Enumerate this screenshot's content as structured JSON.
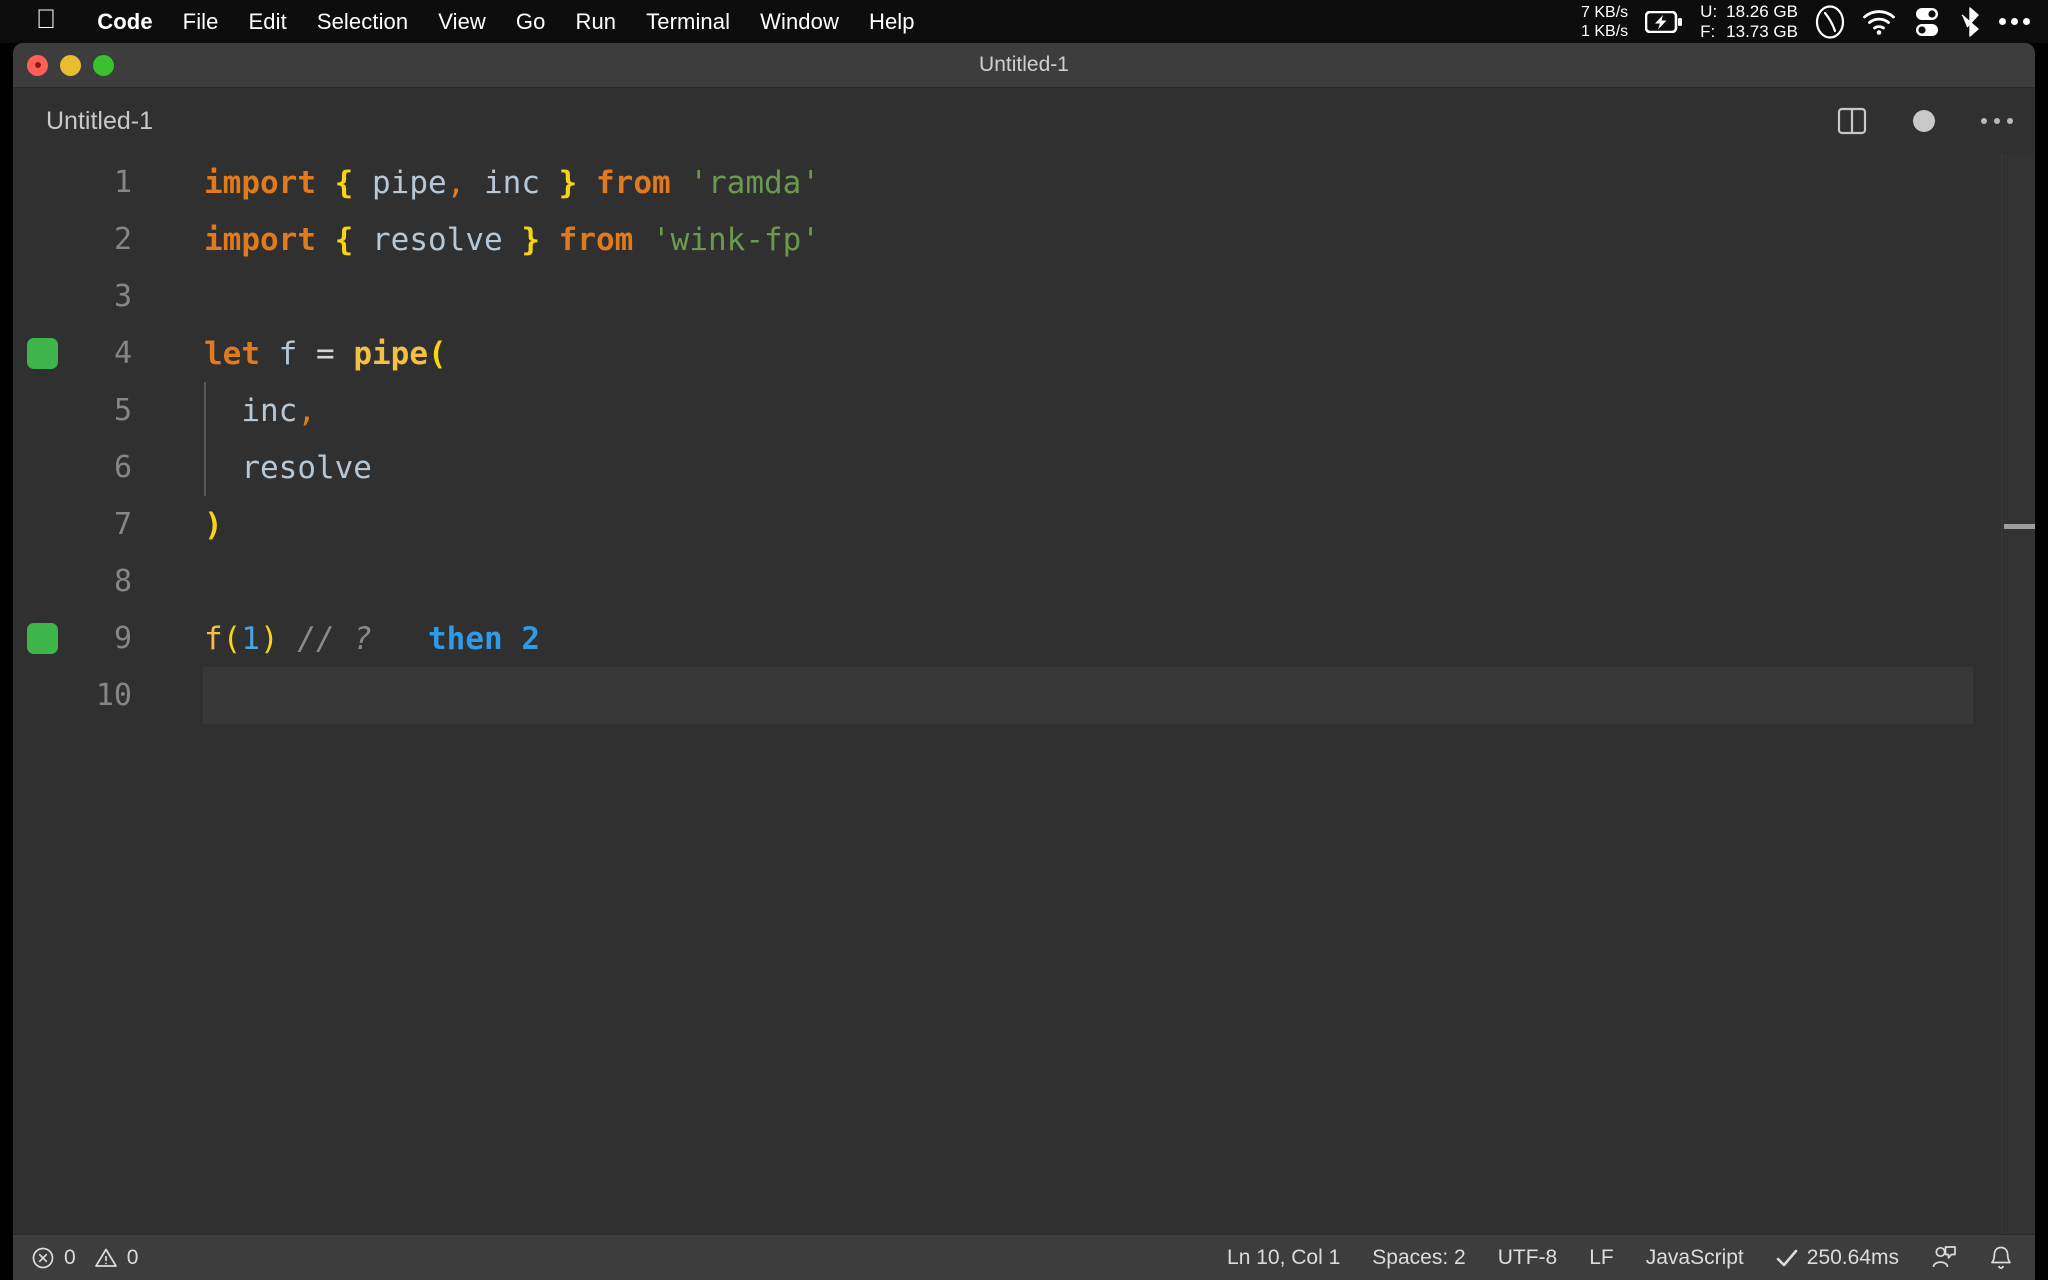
{
  "menubar": {
    "apple_icon": "apple-logo",
    "items": [
      {
        "label": "Code",
        "bold": true
      },
      {
        "label": "File",
        "bold": false
      },
      {
        "label": "Edit",
        "bold": false
      },
      {
        "label": "Selection",
        "bold": false
      },
      {
        "label": "View",
        "bold": false
      },
      {
        "label": "Go",
        "bold": false
      },
      {
        "label": "Run",
        "bold": false
      },
      {
        "label": "Terminal",
        "bold": false
      },
      {
        "label": "Window",
        "bold": false
      },
      {
        "label": "Help",
        "bold": false
      }
    ],
    "status": {
      "net_up": "7 KB/s",
      "net_down": "1 KB/s",
      "battery_icon": "battery-charging-icon",
      "mem_used_label": "U:",
      "mem_used_value": "18.26 GB",
      "mem_free_label": "F:",
      "mem_free_value": "13.73 GB",
      "gauge_icon": "speedometer-icon",
      "wifi_icon": "wifi-icon",
      "toggles_icon": "control-center-icon",
      "bluetooth_icon": "bluetooth-icon",
      "more_icon": "ellipsis-icon"
    }
  },
  "window": {
    "title": "Untitled-1",
    "traffic_lights": [
      "close",
      "minimize",
      "zoom"
    ]
  },
  "tabstrip": {
    "tab_label": "Untitled-1",
    "split_editor_icon": "split-editor-icon",
    "unsaved_dot": "unsaved-changes-dot",
    "more_actions_icon": "ellipsis-icon"
  },
  "editor": {
    "language": "JavaScript",
    "lines": [
      {
        "number": "1",
        "breakpoint": false,
        "current": false,
        "indent_guide": false,
        "tokens": [
          {
            "text": "import",
            "cls": "t-kw"
          },
          {
            "text": " ",
            "cls": "t-op"
          },
          {
            "text": "{",
            "cls": "t-brace"
          },
          {
            "text": " ",
            "cls": "t-op"
          },
          {
            "text": "pipe",
            "cls": "t-var"
          },
          {
            "text": ",",
            "cls": "t-punc"
          },
          {
            "text": " ",
            "cls": "t-op"
          },
          {
            "text": "inc",
            "cls": "t-var"
          },
          {
            "text": " ",
            "cls": "t-op"
          },
          {
            "text": "}",
            "cls": "t-brace"
          },
          {
            "text": " ",
            "cls": "t-op"
          },
          {
            "text": "from",
            "cls": "t-kw"
          },
          {
            "text": " ",
            "cls": "t-op"
          },
          {
            "text": "'ramda'",
            "cls": "t-str"
          }
        ]
      },
      {
        "number": "2",
        "breakpoint": false,
        "current": false,
        "indent_guide": false,
        "tokens": [
          {
            "text": "import",
            "cls": "t-kw"
          },
          {
            "text": " ",
            "cls": "t-op"
          },
          {
            "text": "{",
            "cls": "t-brace"
          },
          {
            "text": " ",
            "cls": "t-op"
          },
          {
            "text": "resolve",
            "cls": "t-var"
          },
          {
            "text": " ",
            "cls": "t-op"
          },
          {
            "text": "}",
            "cls": "t-brace"
          },
          {
            "text": " ",
            "cls": "t-op"
          },
          {
            "text": "from",
            "cls": "t-kw"
          },
          {
            "text": " ",
            "cls": "t-op"
          },
          {
            "text": "'wink-fp'",
            "cls": "t-str"
          }
        ]
      },
      {
        "number": "3",
        "breakpoint": false,
        "current": false,
        "indent_guide": false,
        "tokens": []
      },
      {
        "number": "4",
        "breakpoint": true,
        "current": false,
        "indent_guide": false,
        "tokens": [
          {
            "text": "let",
            "cls": "t-kw"
          },
          {
            "text": " ",
            "cls": "t-op"
          },
          {
            "text": "f",
            "cls": "t-var"
          },
          {
            "text": " ",
            "cls": "t-op"
          },
          {
            "text": "=",
            "cls": "t-op"
          },
          {
            "text": " ",
            "cls": "t-op"
          },
          {
            "text": "pipe",
            "cls": "t-fn"
          },
          {
            "text": "(",
            "cls": "t-brace"
          }
        ]
      },
      {
        "number": "5",
        "breakpoint": false,
        "current": false,
        "indent_guide": true,
        "tokens": [
          {
            "text": "  ",
            "cls": "t-op"
          },
          {
            "text": "inc",
            "cls": "t-var"
          },
          {
            "text": ",",
            "cls": "t-punc"
          }
        ]
      },
      {
        "number": "6",
        "breakpoint": false,
        "current": false,
        "indent_guide": true,
        "tokens": [
          {
            "text": "  ",
            "cls": "t-op"
          },
          {
            "text": "resolve",
            "cls": "t-var"
          }
        ]
      },
      {
        "number": "7",
        "breakpoint": false,
        "current": false,
        "indent_guide": false,
        "tokens": [
          {
            "text": ")",
            "cls": "t-brace"
          }
        ]
      },
      {
        "number": "8",
        "breakpoint": false,
        "current": false,
        "indent_guide": false,
        "tokens": []
      },
      {
        "number": "9",
        "breakpoint": true,
        "current": false,
        "indent_guide": false,
        "tokens": [
          {
            "text": "f",
            "cls": "t-fn-plain"
          },
          {
            "text": "(",
            "cls": "t-paren"
          },
          {
            "text": "1",
            "cls": "t-num"
          },
          {
            "text": ")",
            "cls": "t-paren"
          },
          {
            "text": " ",
            "cls": "t-op"
          },
          {
            "text": "// ?",
            "cls": "t-comment"
          },
          {
            "text": "   ",
            "cls": "t-op"
          },
          {
            "text": "then 2",
            "cls": "t-hint"
          }
        ]
      },
      {
        "number": "10",
        "breakpoint": false,
        "current": true,
        "indent_guide": false,
        "tokens": []
      }
    ]
  },
  "statusbar": {
    "errors_icon": "error-circle-icon",
    "errors_count": "0",
    "warnings_icon": "warning-triangle-icon",
    "warnings_count": "0",
    "cursor_position": "Ln 10, Col 1",
    "indentation": "Spaces: 2",
    "encoding": "UTF-8",
    "eol": "LF",
    "language_mode": "JavaScript",
    "run_check_icon": "checkmark-icon",
    "run_time": "250.64ms",
    "feedback_icon": "feedback-person-icon",
    "notifications_icon": "bell-icon"
  },
  "colors": {
    "menubar_bg": "#0d0d0d",
    "titlebar_bg": "#3d3d3d",
    "editor_bg": "#303030",
    "current_line_bg": "#383838",
    "statusbar_bg": "#3d3d3d",
    "keyword": "#e07a1f",
    "brace": "#f7d417",
    "variable": "#b6c7d6",
    "string": "#6a9a4e",
    "function": "#f5bf42",
    "number": "#4ca3e0",
    "comment": "#8a8a8a",
    "inline_hint": "#2f9ae8",
    "breakpoint_green": "#3eb54a"
  }
}
